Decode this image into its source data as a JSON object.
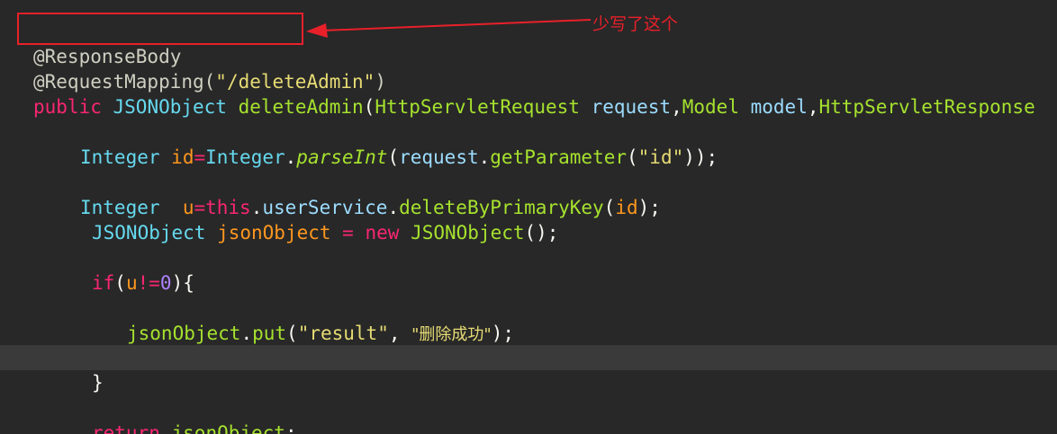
{
  "editor": {
    "lines": {
      "l1": [
        "@ResponseBody"
      ],
      "l2": [
        "@RequestMapping(",
        "\"/deleteAdmin\"",
        ")"
      ],
      "l3": [
        "public",
        " ",
        "JSONObject",
        " ",
        "deleteAdmin",
        "(",
        "HttpServletRequest",
        " ",
        "request",
        ",",
        "Model",
        " ",
        "model",
        ",",
        "HttpServletResponse"
      ],
      "l5": [
        "Integer",
        " ",
        "id",
        "=",
        "Integer",
        ".",
        "parseInt",
        "(",
        "request",
        ".",
        "getParameter",
        "(",
        "\"id\"",
        "));"
      ],
      "l7": [
        "Integer",
        "  ",
        "u",
        "=",
        "this",
        ".",
        "userService",
        ".",
        "deleteByPrimaryKey",
        "(",
        "id",
        ");"
      ],
      "l8": [
        "JSONObject",
        " ",
        "jsonObject",
        " = ",
        "new",
        " ",
        "JSONObject",
        "();"
      ],
      "l10": [
        "if",
        "(",
        "u",
        "!=",
        "0",
        "){"
      ],
      "l12": [
        "jsonObject",
        ".",
        "put",
        "(",
        "\"result\"",
        ", ",
        "\"删除成功\"",
        ");"
      ],
      "l14": [
        "}"
      ],
      "l16": [
        "return",
        " ",
        "jsonObject",
        ";"
      ]
    }
  },
  "annotation": {
    "note": "少写了这个",
    "color": "#e8202a"
  }
}
